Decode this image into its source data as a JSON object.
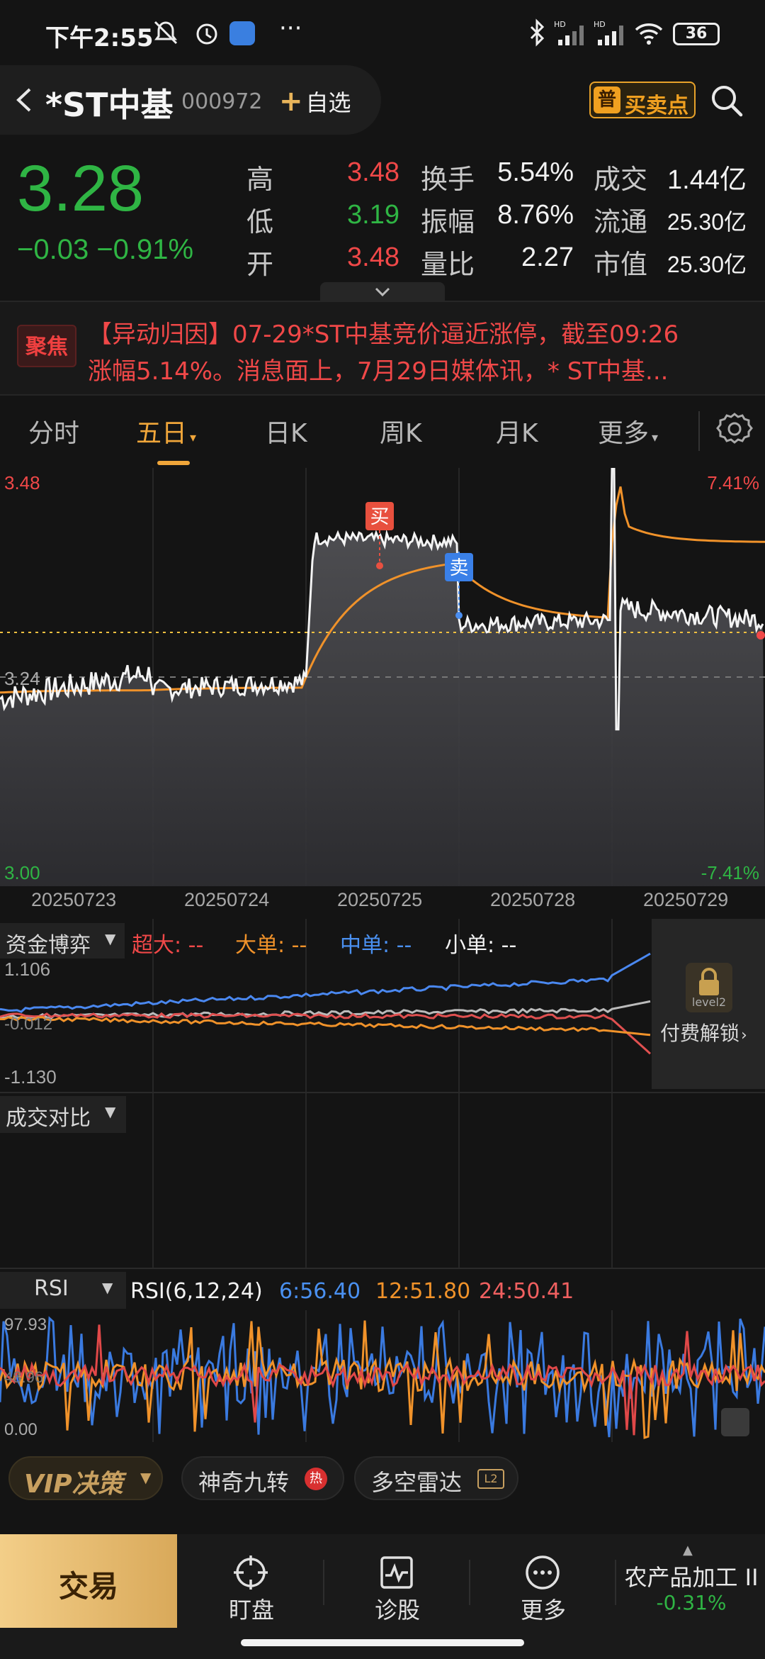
{
  "status": {
    "time": "下午2:55",
    "dots": "···",
    "battery": "36"
  },
  "header": {
    "stock_name": "*ST中基",
    "stock_code": "000972",
    "add_watch_label": "自选",
    "buy_sell_label": "买卖点",
    "buy_sell_icon_text": "普"
  },
  "quote": {
    "price": "3.28",
    "change": "−0.03  −0.91%",
    "rows": [
      {
        "l1": "高",
        "v1": "3.48",
        "c1": "#f04848",
        "l2": "换手",
        "v2": "5.54%",
        "l3": "成交",
        "v3": "1.44亿"
      },
      {
        "l1": "低",
        "v1": "3.19",
        "c1": "#2fb544",
        "l2": "振幅",
        "v2": "8.76%",
        "l3": "流通",
        "v3": "25.30亿"
      },
      {
        "l1": "开",
        "v1": "3.48",
        "c1": "#f04848",
        "l2": "量比",
        "v2": "2.27",
        "l3": "市值",
        "v3": "25.30亿"
      }
    ]
  },
  "news": {
    "badge": "聚焦",
    "line1": "【异动归因】07-29*ST中基竞价逼近涨停，截至09:26",
    "line2": "涨幅5.14%。消息面上，7月29日媒体讯，* ST中基..."
  },
  "tabs": [
    "分时",
    "五日",
    "日K",
    "周K",
    "月K",
    "更多"
  ],
  "active_tab": "五日",
  "chart": {
    "y_top": "3.48",
    "y_mid": "3.24",
    "y_bottom": "3.00",
    "pct_top": "7.41%",
    "pct_bottom": "-7.41%",
    "buy_marker": "买",
    "sell_marker": "卖",
    "dates": [
      "20250723",
      "20250724",
      "20250725",
      "20250728",
      "20250729"
    ]
  },
  "flow": {
    "title": "资金博弈",
    "super": "超大: --",
    "big": "大单: --",
    "mid": "中单: --",
    "small": "小单: --",
    "y_top": "1.106",
    "y_mid": "-0.012",
    "y_bottom": "-1.130",
    "lock_label": "付费解锁",
    "lock_sub": "level2"
  },
  "volcmp": {
    "title": "成交对比"
  },
  "rsi": {
    "title": "RSI",
    "params": "RSI(6,12,24)",
    "r6": "6:56.40",
    "r12": "12:51.80",
    "r24": "24:50.41",
    "y_top": "97.93",
    "y_mid": "48.96",
    "y_bottom": "0.00"
  },
  "pills": {
    "vip": "VIP决策",
    "p1": "神奇九转",
    "p1_badge": "热",
    "p2": "多空雷达",
    "p2_badge": "L2"
  },
  "nav": {
    "trade": "交易",
    "items": [
      "盯盘",
      "诊股",
      "更多"
    ],
    "sector": "农产品加工 II",
    "sector_change": "-0.31%"
  },
  "colors": {
    "up": "#f04848",
    "down": "#2fb544",
    "accent": "#f0a63a",
    "avg_line": "#f0922a"
  }
}
